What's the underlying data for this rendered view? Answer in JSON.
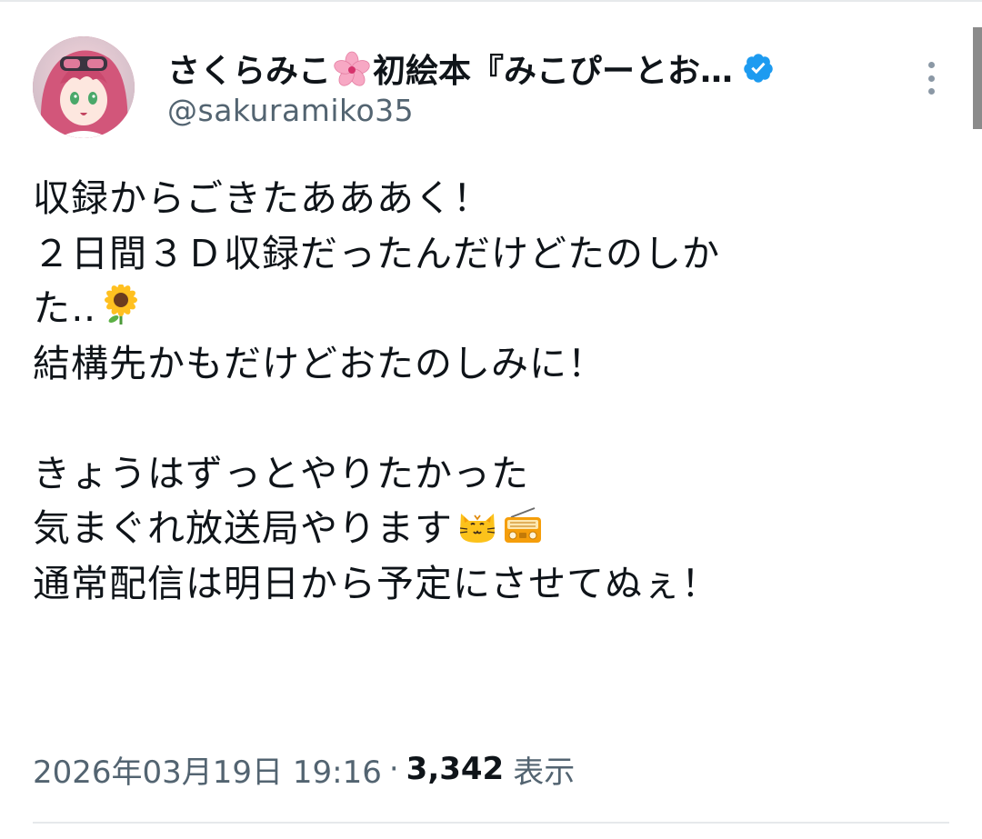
{
  "author": {
    "display_name_part1": "さくらみこ",
    "flower_icon": "cherry-blossom-emoji",
    "display_name_part2": "初絵本『みこぴーとお…",
    "handle": "@sakuramiko35",
    "verified": true
  },
  "tweet": {
    "lines": [
      "収録からごきたあああく！",
      "２日間３Ｄ収録だったんだけどたのしか",
      "た‥",
      "結構先かもだけどおたのしみに！",
      "",
      "きょうはずっとやりたかった",
      "気まぐれ放送局やります",
      "通常配信は明日から予定にさせてぬぇ！"
    ],
    "emojis": {
      "line3": "sunflower-emoji",
      "line7a": "cat-face-emoji",
      "line7b": "radio-emoji"
    }
  },
  "meta": {
    "timestamp": "2026年03月19日 19:16",
    "separator": "·",
    "view_count": "3,342",
    "view_label": "表示"
  },
  "colors": {
    "verified_blue": "#1d9bf0",
    "secondary_text": "#536471",
    "primary_text": "#0f1419"
  }
}
